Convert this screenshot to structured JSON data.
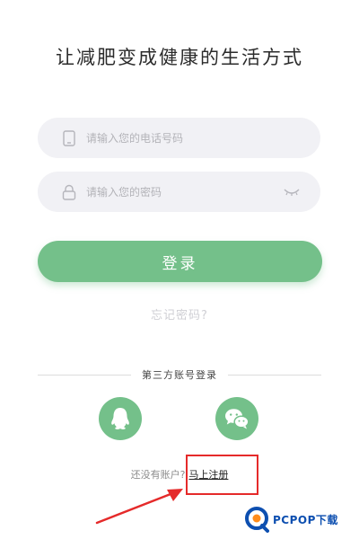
{
  "slogan": "让减肥变成健康的生活方式",
  "phone_field": {
    "placeholder": "请输入您的电话号码",
    "value": ""
  },
  "password_field": {
    "placeholder": "请输入您的密码",
    "value": ""
  },
  "login_button": {
    "label": "登录"
  },
  "forgot_password": {
    "label": "忘记密码?"
  },
  "third_party": {
    "label": "第三方账号登录",
    "providers": [
      {
        "icon": "qq-icon"
      },
      {
        "icon": "wechat-icon"
      }
    ]
  },
  "register": {
    "prompt": "还没有账户?",
    "link": "马上注册"
  },
  "watermark": {
    "text": "PCPOP下载"
  },
  "colors": {
    "accent": "#74c08a",
    "field_bg": "#f1f1f5",
    "annotation_red": "#e52a2a",
    "watermark_blue": "#0d4fb0"
  }
}
